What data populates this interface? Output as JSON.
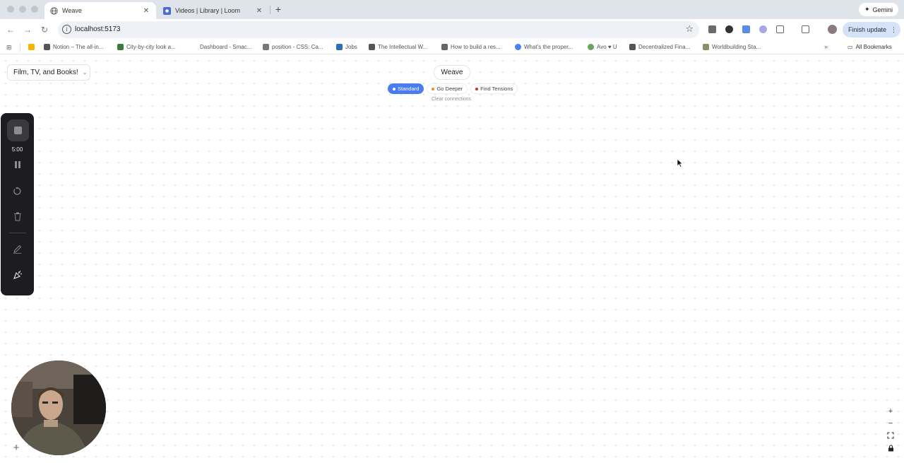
{
  "browser": {
    "tabs": [
      {
        "title": "Weave",
        "active": true
      },
      {
        "title": "Videos | Library | Loom",
        "active": false
      }
    ],
    "gemini_label": "Gemini",
    "url": "localhost:5173",
    "finish_update_label": "Finish update",
    "bookmarks": [
      "Notion – The all-in...",
      "City-by-city look a...",
      "Dashboard - Smac...",
      "position - CSS: Ca...",
      "Jobs",
      "The Intellectual W...",
      "How to build a res...",
      "What's the proper...",
      "Avo ♥ U",
      "Decentralized Fina...",
      "Worldbuilding Sta..."
    ],
    "all_bookmarks_label": "All Bookmarks"
  },
  "app": {
    "project_select": "Film, TV, and Books!",
    "title": "Weave",
    "modes": [
      {
        "label": "Standard",
        "dot_color": "#ffffff",
        "active": true
      },
      {
        "label": "Go Deeper",
        "dot_color": "#e0912f",
        "active": false
      },
      {
        "label": "Find Tensions",
        "dot_color": "#c0392b",
        "active": false
      }
    ],
    "clear_label": "Clear connections",
    "accent_color": "#4a7cf0"
  },
  "loom": {
    "timer": "5:00"
  }
}
